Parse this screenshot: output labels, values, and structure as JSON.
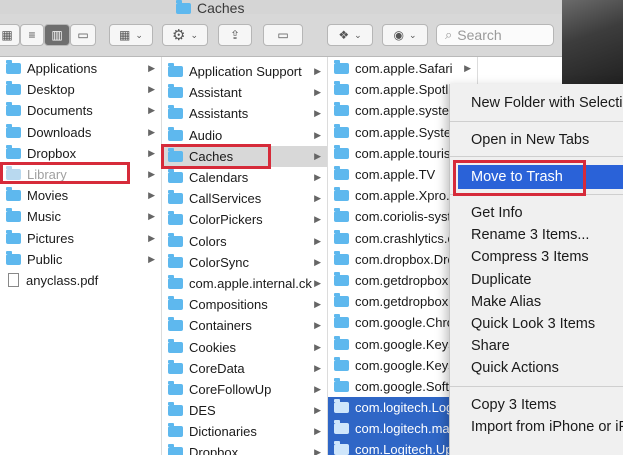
{
  "window": {
    "title": "Caches"
  },
  "toolbar": {
    "search_placeholder": "Search"
  },
  "col1": [
    {
      "label": "Applications",
      "icon": "folder",
      "arrow": true
    },
    {
      "label": "Desktop",
      "icon": "folder",
      "arrow": true
    },
    {
      "label": "Documents",
      "icon": "folder",
      "arrow": true
    },
    {
      "label": "Downloads",
      "icon": "folder",
      "arrow": true
    },
    {
      "label": "Dropbox",
      "icon": "folder",
      "arrow": true
    },
    {
      "label": "Library",
      "icon": "folder",
      "arrow": true,
      "state": "dim"
    },
    {
      "label": "Movies",
      "icon": "folder",
      "arrow": true
    },
    {
      "label": "Music",
      "icon": "folder",
      "arrow": true
    },
    {
      "label": "Pictures",
      "icon": "folder",
      "arrow": true
    },
    {
      "label": "Public",
      "icon": "folder",
      "arrow": true
    },
    {
      "label": "anyclass.pdf",
      "icon": "doc",
      "arrow": false
    }
  ],
  "col2": [
    {
      "label": "Application Support"
    },
    {
      "label": "Assistant"
    },
    {
      "label": "Assistants"
    },
    {
      "label": "Audio"
    },
    {
      "label": "Caches",
      "state": "sel"
    },
    {
      "label": "Calendars"
    },
    {
      "label": "CallServices"
    },
    {
      "label": "ColorPickers"
    },
    {
      "label": "Colors"
    },
    {
      "label": "ColorSync"
    },
    {
      "label": "com.apple.internal.ck"
    },
    {
      "label": "Compositions"
    },
    {
      "label": "Containers"
    },
    {
      "label": "Cookies"
    },
    {
      "label": "CoreData"
    },
    {
      "label": "CoreFollowUp"
    },
    {
      "label": "DES"
    },
    {
      "label": "Dictionaries"
    },
    {
      "label": "Dropbox"
    }
  ],
  "col3": [
    {
      "label": "com.apple.Safari"
    },
    {
      "label": "com.apple.Spotlight"
    },
    {
      "label": "com.apple.systen"
    },
    {
      "label": "com.apple.Systen"
    },
    {
      "label": "com.apple.tourist"
    },
    {
      "label": "com.apple.TV"
    },
    {
      "label": "com.apple.Xpro..."
    },
    {
      "label": "com.coriolis-syst"
    },
    {
      "label": "com.crashlytics.c"
    },
    {
      "label": "com.dropbox.Dro"
    },
    {
      "label": "com.getdropbox.c"
    },
    {
      "label": "com.getdropbox..."
    },
    {
      "label": "com.google.Chro"
    },
    {
      "label": "com.google.Keys"
    },
    {
      "label": "com.google.Keys"
    },
    {
      "label": "com.google.Softw"
    },
    {
      "label": "com.logitech.Log",
      "state": "hl"
    },
    {
      "label": "com.logitech.mar",
      "state": "hl"
    },
    {
      "label": "com.Logitech.Up",
      "state": "hl"
    }
  ],
  "context_menu": {
    "new_folder": "New Folder with Selecti",
    "open_tabs": "Open in New Tabs",
    "move_trash": "Move to Trash",
    "get_info": "Get Info",
    "rename": "Rename 3 Items...",
    "compress": "Compress 3 Items",
    "duplicate": "Duplicate",
    "make_alias": "Make Alias",
    "quick_look": "Quick Look 3 Items",
    "share": "Share",
    "quick_actions": "Quick Actions",
    "copy": "Copy 3 Items",
    "import_iphone": "Import from iPhone or iP"
  },
  "colors": {
    "accent": "#2a62d8",
    "folder": "#5eb8ee",
    "annotation": "#d62b3a"
  }
}
